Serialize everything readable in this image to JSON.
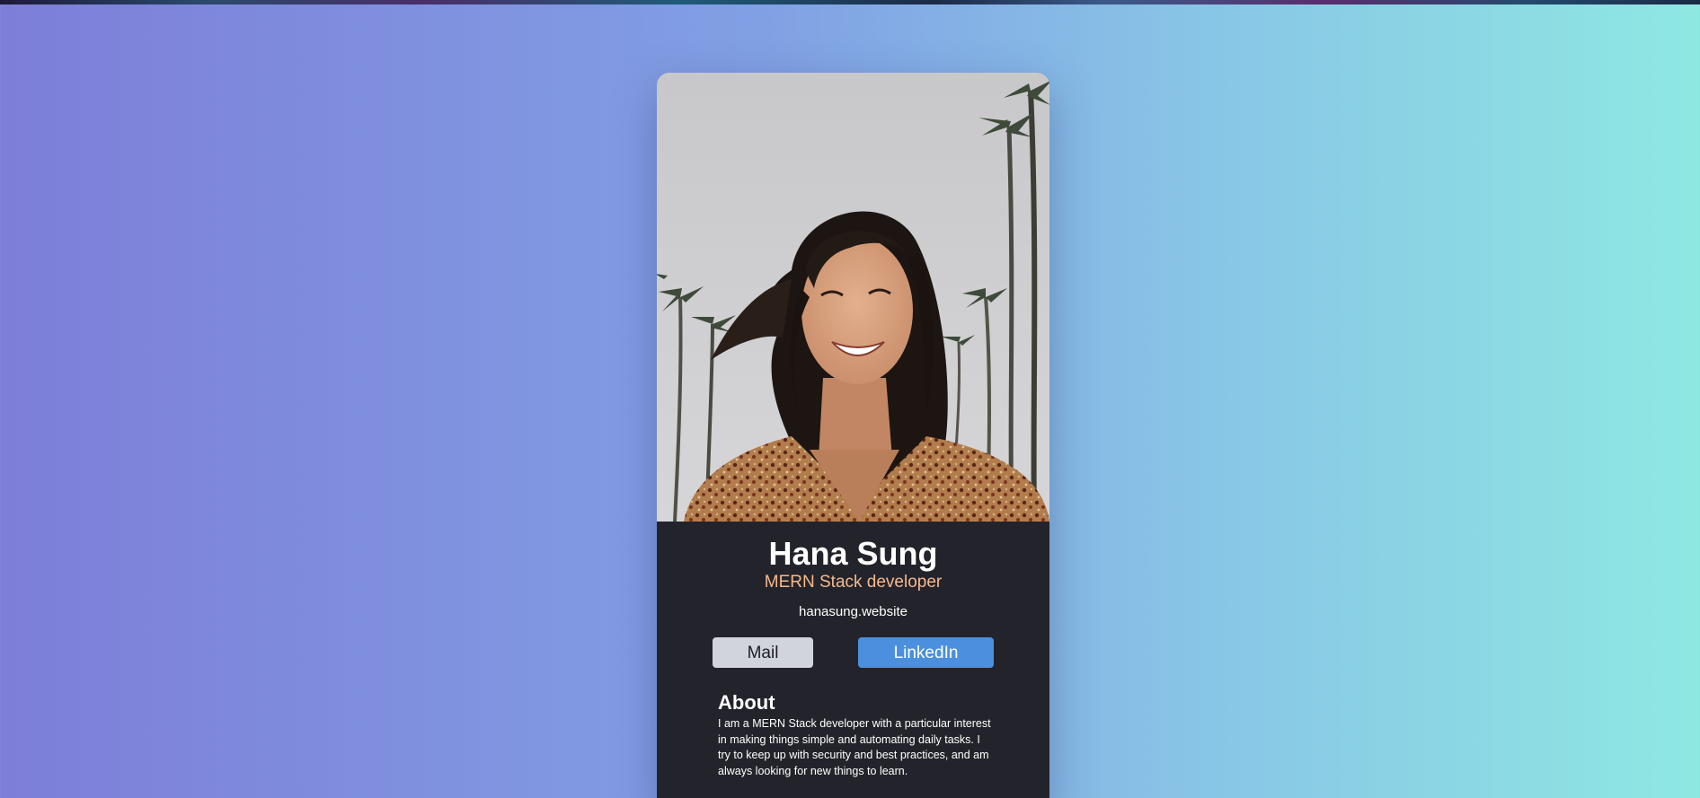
{
  "profile": {
    "name": "Hana Sung",
    "role": "MERN Stack developer",
    "website": "hanasung.website",
    "photo_description_icon": "portrait-photo"
  },
  "buttons": {
    "mail_label": "Mail",
    "linkedin_label": "LinkedIn"
  },
  "about": {
    "title": "About",
    "text": "I am a MERN Stack developer with a particular interest in making things simple and automating daily tasks. I try to keep up with security and best practices, and am always looking for new things to learn."
  },
  "colors": {
    "card_background": "#23242b",
    "role_accent": "#f5b98e",
    "mail_button": "#d1d4dc",
    "linkedin_button": "#4a90df"
  }
}
